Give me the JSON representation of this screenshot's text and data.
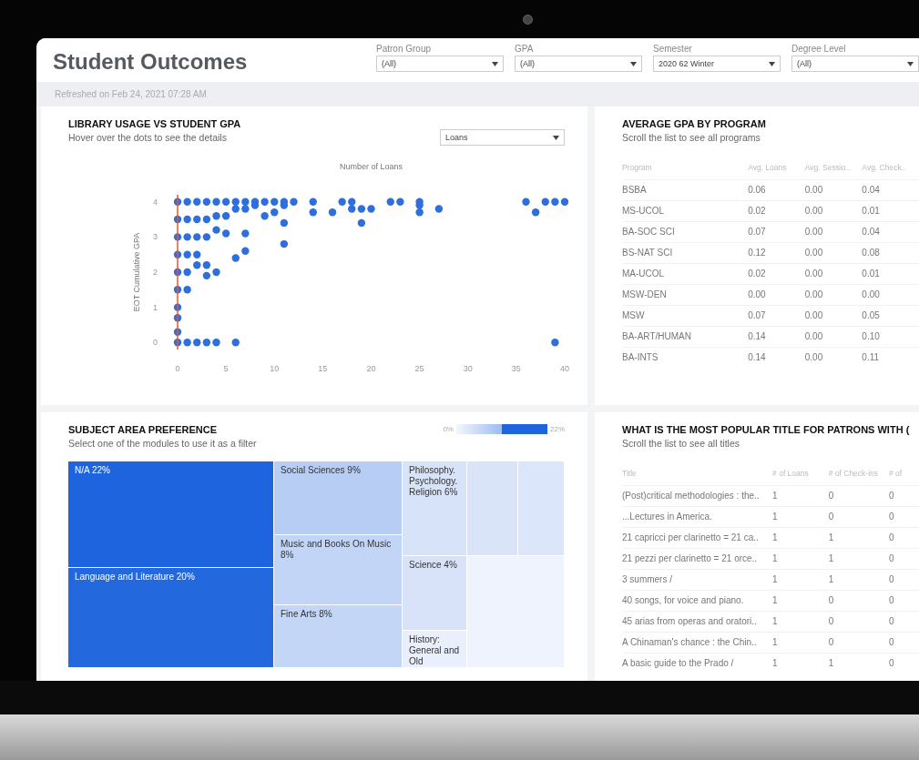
{
  "header": {
    "title": "Student Outcomes",
    "refreshed": "Refreshed on Feb 24, 2021  07:28 AM",
    "filters": [
      {
        "label": "Patron Group",
        "value": "(All)"
      },
      {
        "label": "GPA",
        "value": "(All)"
      },
      {
        "label": "Semester",
        "value": "2020 62 Winter"
      },
      {
        "label": "Degree Level",
        "value": "(All)"
      }
    ]
  },
  "usage": {
    "title": "LIBRARY USAGE VS STUDENT GPA",
    "subtitle": "Hover over the dots to see the details",
    "measure": "Loans",
    "chart_data": {
      "type": "scatter",
      "xlabel": "Number of Loans",
      "ylabel": "EOT Cumulative GPA",
      "xlim": [
        0,
        40
      ],
      "ylim": [
        -0.2,
        4.2
      ],
      "xticks": [
        0,
        5,
        10,
        15,
        20,
        25,
        30,
        35,
        40
      ],
      "yticks": [
        0,
        1,
        2,
        3,
        4
      ],
      "x": [
        0,
        0,
        0,
        0,
        0,
        0,
        0,
        0,
        0,
        0,
        1,
        1,
        1,
        1,
        1,
        1,
        1,
        2,
        2,
        2,
        2,
        2,
        2,
        3,
        3,
        3,
        3,
        3,
        3,
        4,
        4,
        4,
        4,
        4,
        5,
        5,
        5,
        6,
        6,
        6,
        6,
        7,
        7,
        7,
        7,
        8,
        8,
        9,
        9,
        10,
        10,
        11,
        11,
        11,
        11,
        12,
        14,
        14,
        16,
        17,
        18,
        18,
        19,
        19,
        20,
        22,
        23,
        25,
        25,
        25,
        27,
        36,
        37,
        38,
        39,
        39,
        40
      ],
      "series": [
        {
          "color": "#2e6fdc",
          "values": [
            4,
            3.5,
            3,
            2.5,
            2,
            1.5,
            1,
            0.7,
            0.3,
            0,
            4,
            3.5,
            3,
            2.5,
            2,
            1.5,
            0,
            4,
            3.5,
            3,
            2.5,
            2.2,
            0,
            4,
            3.5,
            3,
            2.2,
            1.9,
            0,
            4,
            3.6,
            3.2,
            2,
            0,
            4,
            3.6,
            3.1,
            4,
            3.8,
            2.4,
            0,
            4,
            3.8,
            3.1,
            2.6,
            4,
            3.9,
            4,
            3.6,
            4,
            3.7,
            4,
            3.9,
            3.4,
            2.8,
            4,
            4,
            3.7,
            3.7,
            4,
            4,
            3.8,
            3.4,
            3.8,
            3.8,
            4,
            4,
            4,
            3.9,
            3.7,
            3.8,
            4,
            3.7,
            4,
            4,
            0,
            4
          ]
        }
      ]
    }
  },
  "programs": {
    "title": "AVERAGE GPA BY PROGRAM",
    "subtitle": "Scroll the list to see all programs",
    "columns": [
      "Program",
      "Avg. Loans",
      "Avg. Sessio..",
      "Avg. Check.."
    ],
    "rows": [
      [
        "BSBA",
        "0.06",
        "0.00",
        "0.04"
      ],
      [
        "MS-UCOL",
        "0.02",
        "0.00",
        "0.01"
      ],
      [
        "BA-SOC SCI",
        "0.07",
        "0.00",
        "0.04"
      ],
      [
        "BS-NAT SCI",
        "0.12",
        "0.00",
        "0.08"
      ],
      [
        "MA-UCOL",
        "0.02",
        "0.00",
        "0.01"
      ],
      [
        "MSW-DEN",
        "0.00",
        "0.00",
        "0.00"
      ],
      [
        "MSW",
        "0.07",
        "0.00",
        "0.05"
      ],
      [
        "BA-ART/HUMAN",
        "0.14",
        "0.00",
        "0.10"
      ],
      [
        "BA-INTS",
        "0.14",
        "0.00",
        "0.11"
      ]
    ]
  },
  "subjects": {
    "title": "SUBJECT AREA PREFERENCE",
    "subtitle": "Select one of the modules to use it as a filter",
    "legend_min": "0%",
    "legend_max": "22%",
    "tiles": [
      {
        "label": "N/A 22%",
        "color": "#1f64df"
      },
      {
        "label": "Language and Literature 20%",
        "color": "#2468dd"
      },
      {
        "label": "Social Sciences 9%",
        "color": "#b8cdf4"
      },
      {
        "label": "Music and Books On Music 8%",
        "color": "#c2d5f6"
      },
      {
        "label": "Fine Arts 8%",
        "color": "#c4d6f6"
      },
      {
        "label": "Philosophy. Psychology. Religion 6%",
        "color": "#d6e3f9"
      },
      {
        "color": "#d9e4f9"
      },
      {
        "color": "#dbe6fa"
      },
      {
        "label": "Science 4%",
        "color": "#d8e3f9"
      },
      {
        "label": "History: General and Old",
        "color": "#e9effc"
      },
      {
        "color": "#eef3fd"
      }
    ]
  },
  "titles": {
    "title": "WHAT IS THE MOST POPULAR TITLE FOR PATRONS WITH (",
    "subtitle": "Scroll the list to see all titles",
    "columns": [
      "Title",
      "# of Loans",
      "# of Check-ins",
      "# of"
    ],
    "rows": [
      [
        "(Post)critical methodologies : the..",
        "1",
        "0",
        "0"
      ],
      [
        "...Lectures in America.",
        "1",
        "0",
        "0"
      ],
      [
        "21 capricci per clarinetto = 21 ca..",
        "1",
        "1",
        "0"
      ],
      [
        "21 pezzi per clarinetto = 21 orce..",
        "1",
        "1",
        "0"
      ],
      [
        "3 summers /",
        "1",
        "1",
        "0"
      ],
      [
        "40 songs, for voice and piano.",
        "1",
        "0",
        "0"
      ],
      [
        "45 arias from operas and oratori..",
        "1",
        "0",
        "0"
      ],
      [
        "A Chinaman's chance : the Chin..",
        "1",
        "0",
        "0"
      ],
      [
        "A basic guide to the Prado /",
        "1",
        "1",
        "0"
      ]
    ]
  }
}
